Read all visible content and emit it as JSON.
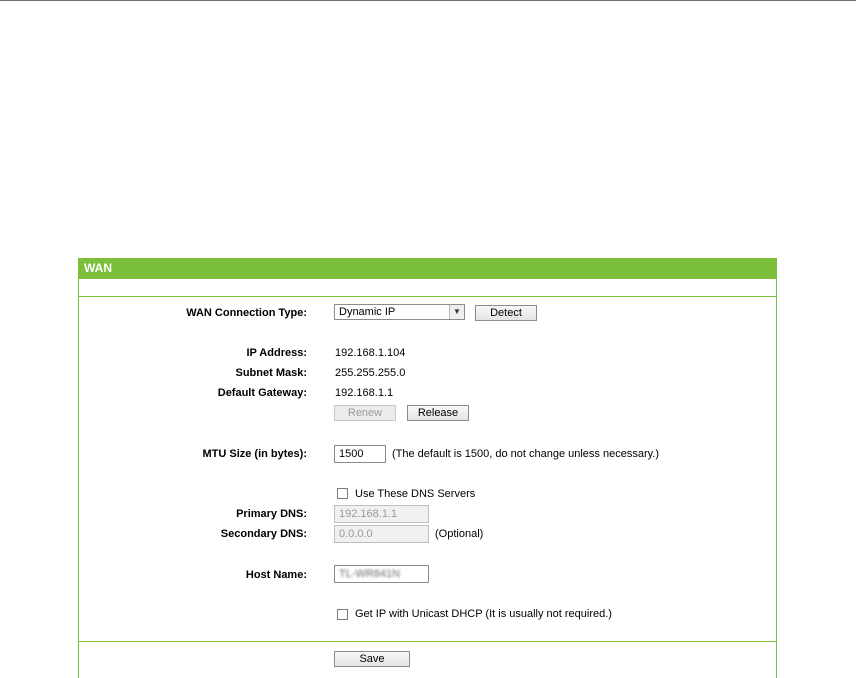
{
  "wan": {
    "header": "WAN",
    "connection_type_label": "WAN Connection Type:",
    "connection_type_value": "Dynamic IP",
    "detect_button": "Detect",
    "ip_address_label": "IP Address:",
    "ip_address_value": "192.168.1.104",
    "subnet_mask_label": "Subnet Mask:",
    "subnet_mask_value": "255.255.255.0",
    "default_gateway_label": "Default Gateway:",
    "default_gateway_value": "192.168.1.1",
    "renew_button": "Renew",
    "release_button": "Release",
    "mtu_label": "MTU Size (in bytes):",
    "mtu_value": "1500",
    "mtu_note": "(The default is 1500, do not change unless necessary.)",
    "use_dns_label": "Use These DNS Servers",
    "use_dns_checked": false,
    "primary_dns_label": "Primary DNS:",
    "primary_dns_value": "192.168.1.1",
    "secondary_dns_label": "Secondary DNS:",
    "secondary_dns_value": "0.0.0.0",
    "secondary_dns_note": "(Optional)",
    "host_name_label": "Host Name:",
    "host_name_value": "TL-WR841N",
    "unicast_label": "Get IP with Unicast DHCP (It is usually not required.)",
    "unicast_checked": false,
    "save_button": "Save"
  },
  "colors": {
    "accent_green": "#7cbf3a"
  }
}
